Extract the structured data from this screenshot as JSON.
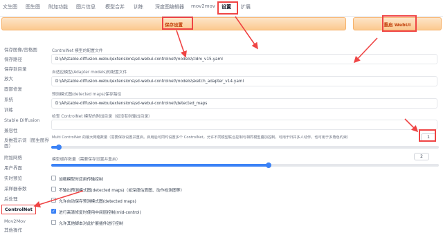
{
  "tabs": [
    "文生图",
    "图生图",
    "附加功能",
    "图片信息",
    "模型合并",
    "训练",
    "深度图编辑器",
    "mov2mov",
    "设置",
    "扩展"
  ],
  "buttons": {
    "save": "保存设置",
    "reload": "重启 WebUI"
  },
  "sidebar": [
    "保存图像/宫格图",
    "保存路径",
    "保存到目录",
    "放大",
    "面部修复",
    "系统",
    "训练",
    "Stable Diffusion",
    "兼容性",
    "反推提示词（图生图界面）",
    "附加网络",
    "用户界面",
    "实时预览",
    "采样器参数",
    "后处理",
    "ControlNet",
    "Mov2Mov",
    "其他操作"
  ],
  "settings": {
    "config_label": "ControlNet 模型的配置文件",
    "config_value": "D:\\AI\\stable-diffusion-webui\\extensions\\sd-webui-controlnet\\models\\cldm_v15.yaml",
    "adapter_label": "自适应模型(Adapter models)的配置文件",
    "adapter_value": "D:\\AI\\stable-diffusion-webui\\extensions\\sd-webui-controlnet\\models\\sketch_adapter_v14.yaml",
    "detect_label": "预测模式图(detected maps)保存路径",
    "detect_value": "D:\\AI\\stable-diffusion-webui\\extensions\\sd-webui-controlnet\\detected_maps",
    "extra_dir_label": "检查 ControlNet 模型的附加目录（如没有则输出目录）",
    "extra_dir_value": "",
    "multi_label": "Multi ControlNet 的最大网络数量（需要保存设置并重启。启用后可同时设置多个 ControlNet，允许不同模型联合控制与相同模型叠加控制，可用于归并多人动作，也可用于多角色约束）",
    "multi_value": "1",
    "multi_fraction": 0.02,
    "cache_label": "模型缓存数量（需要保存设置并重启）",
    "cache_value": "2",
    "cache_fraction": 0.56
  },
  "checkboxes": [
    {
      "label": "加载模型时应用传输控制",
      "checked": false
    },
    {
      "label": "不输出预测模式图(detected maps)（如深度估算图、动作检测图等）",
      "checked": false
    },
    {
      "label": "允许自动保存预测模式图(detected maps)",
      "checked": false
    },
    {
      "label": "进行高清修复时使用中间层控制(mid-control)",
      "checked": true
    },
    {
      "label": "允许其他脚本对此扩展插件进行控制",
      "checked": false
    }
  ]
}
